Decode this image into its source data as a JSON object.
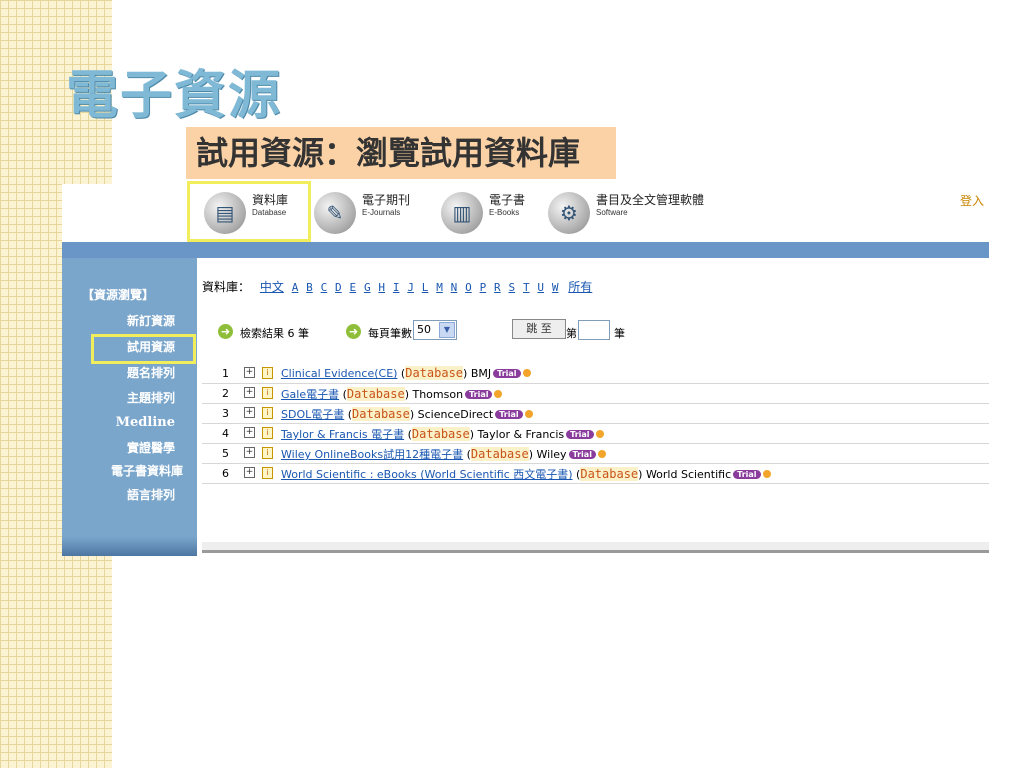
{
  "slide": {
    "title": "電子資源",
    "subtitle": "試用資源：瀏覽試用資料庫"
  },
  "nav": {
    "items": [
      {
        "label": "資料庫",
        "sub": "Database",
        "icon": "database-icon"
      },
      {
        "label": "電子期刊",
        "sub": "E-Journals",
        "icon": "e-journal-icon"
      },
      {
        "label": "電子書",
        "sub": "E-Books",
        "icon": "e-book-icon"
      },
      {
        "label": "書目及全文管理軟體",
        "sub": "Software",
        "icon": "software-icon"
      }
    ],
    "login": "登入"
  },
  "sidebar": {
    "header": "【資源瀏覽】",
    "items": [
      "新訂資源",
      "試用資源",
      "題名排列",
      "主題排列",
      "Medline",
      "實證醫學",
      "電子書資料庫",
      "語言排列"
    ]
  },
  "alpha": {
    "label": "資料庫：",
    "letters": [
      "中文",
      "A",
      "B",
      "C",
      "D",
      "E",
      "G",
      "H",
      "I",
      "J",
      "L",
      "M",
      "N",
      "O",
      "P",
      "R",
      "S",
      "T",
      "U",
      "W",
      "所有"
    ]
  },
  "controls": {
    "result_text": "檢索結果 6 筆",
    "per_page_label": "每頁筆數",
    "per_page_value": "50",
    "jump_label": "跳 至",
    "page_prefix": "第",
    "page_suffix": "筆"
  },
  "results": [
    {
      "num": "1",
      "title": "Clinical Evidence(CE)",
      "type": "Database",
      "publisher": "BMJ"
    },
    {
      "num": "2",
      "title": "Gale電子書",
      "type": "Database",
      "publisher": "Thomson"
    },
    {
      "num": "3",
      "title": "SDOL電子書",
      "type": "Database",
      "publisher": "ScienceDirect"
    },
    {
      "num": "4",
      "title": "Taylor & Francis 電子書",
      "type": "Database",
      "publisher": "Taylor & Francis"
    },
    {
      "num": "5",
      "title": "Wiley OnlineBooks試用12種電子書",
      "type": "Database",
      "publisher": "Wiley"
    },
    {
      "num": "6",
      "title": "World Scientific : eBooks (World Scientific 西文電子書)",
      "type": "Database",
      "publisher": "World Scientific"
    }
  ],
  "trial_badge": "Trial"
}
